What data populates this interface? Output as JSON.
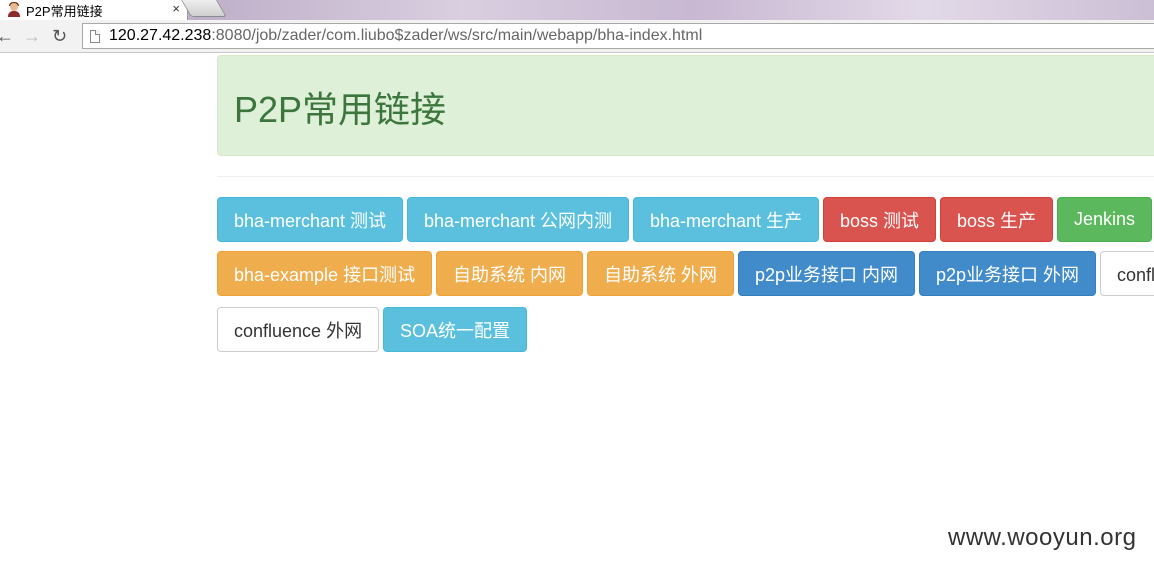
{
  "browser": {
    "tab_title": "P2P常用链接",
    "tab_close": "×",
    "url_host": "120.27.42.238",
    "url_rest": ":8080/job/zader/com.liubo$zader/ws/src/main/webapp/bha-index.html",
    "back_glyph": "←",
    "forward_glyph": "→",
    "reload_glyph": "↻"
  },
  "page": {
    "heading": "P2P常用链接",
    "buttons": [
      {
        "label": "bha-merchant 测试",
        "style": "info"
      },
      {
        "label": "bha-merchant 公网内测",
        "style": "info"
      },
      {
        "label": "bha-merchant 生产",
        "style": "info"
      },
      {
        "label": "boss 测试",
        "style": "danger"
      },
      {
        "label": "boss 生产",
        "style": "danger"
      },
      {
        "label": "Jenkins",
        "style": "success"
      },
      {
        "label": "bha-example 接口测试",
        "style": "warning"
      },
      {
        "label": "自助系统 内网",
        "style": "warning"
      },
      {
        "label": "自助系统 外网",
        "style": "warning"
      },
      {
        "label": "p2p业务接口 内网",
        "style": "primary"
      },
      {
        "label": "p2p业务接口 外网",
        "style": "primary"
      },
      {
        "label": "confluence 内网",
        "style": "default"
      },
      {
        "label": "confluence 外网",
        "style": "default"
      },
      {
        "label": "SOA统一配置",
        "style": "info"
      }
    ]
  },
  "watermark": "www.wooyun.org",
  "colors": {
    "info": "#5bc0de",
    "danger": "#d9534f",
    "success": "#5cb85c",
    "warning": "#f0ad4e",
    "primary": "#428bca",
    "default": "#ffffff",
    "jumbotron_bg": "#dff0d8",
    "jumbotron_text": "#3c763d"
  },
  "icons": {
    "favicon": "user-avatar-icon",
    "page": "page-icon"
  }
}
